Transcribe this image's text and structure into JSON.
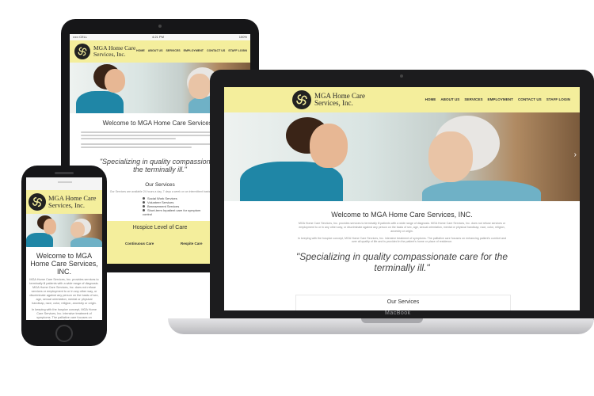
{
  "brand": {
    "line1": "MGA Home Care",
    "line2": "Services, Inc.",
    "accent": "#f4ee9c",
    "teal": "#1f86a6"
  },
  "nav": [
    "HOME",
    "ABOUT US",
    "SERVICES",
    "EMPLOYMENT",
    "CONTACT US",
    "STAFF LOGIN"
  ],
  "status_bar": {
    "carrier": "••••• CELL",
    "time": "4:21 PM",
    "battery": "100%"
  },
  "laptop": {
    "welcome": "Welcome to MGA Home Care Services, INC.",
    "intro": "MGA Home Care Services, Inc. provides services to terminally ill patients with a wide range of diagnosis. MGA Home Care Services, Inc. does not refuse services or employment to or in any other way, or discriminate against any person on the basis of sex, age, sexual orientation, mental or physical handicap, race, color, religion, ancestry or origin.",
    "intro2": "In keeping with the hospice concept, MGA Home Care Services, Inc. intensive treatment of symptoms. The palliative care focuses on enhancing patient's comfort and over all quality of life and is provided in the patient's home or place of residence.",
    "quote": "\"Specializing in quality compassionate care for the terminally ill.\"",
    "services_title": "Our Services",
    "brand_label": "MacBook"
  },
  "tablet": {
    "welcome": "Welcome to MGA Home Care Services, I",
    "quote_line1": "\"Specializing in quality compassionate",
    "quote_line2": "the terminally ill.\"",
    "services_title": "Our Services",
    "services_sub": "Our Services are available 24 hours a day, 7 days a week on an intermittent basis",
    "services_col1": [
      "Social Work Services",
      "Volunteer Services",
      "Bereavement Services",
      "Short-term Inpatient care for symptom control"
    ],
    "hospice_title": "Hospice Level of Care",
    "levels": [
      "Continuous Care",
      "Respite Care"
    ]
  },
  "phone": {
    "welcome": "Welcome to MGA Home Care Services, INC.",
    "intro": "MGA Home Care Services, Inc. provides services to terminally ill patients with a wide range of diagnosis. MGA Home Care Services, Inc. does not refuse services or employment to or in any other way, or discriminate against any person on the basis of sex, age, sexual orientation, mental or physical handicap, race, color, religion, ancestry or origin.",
    "intro2": "In keeping with the hospice concept, MGA Home Care Services, Inc. intensive treatment of symptoms. The palliative care focuses on enhancing patient's comfort"
  }
}
